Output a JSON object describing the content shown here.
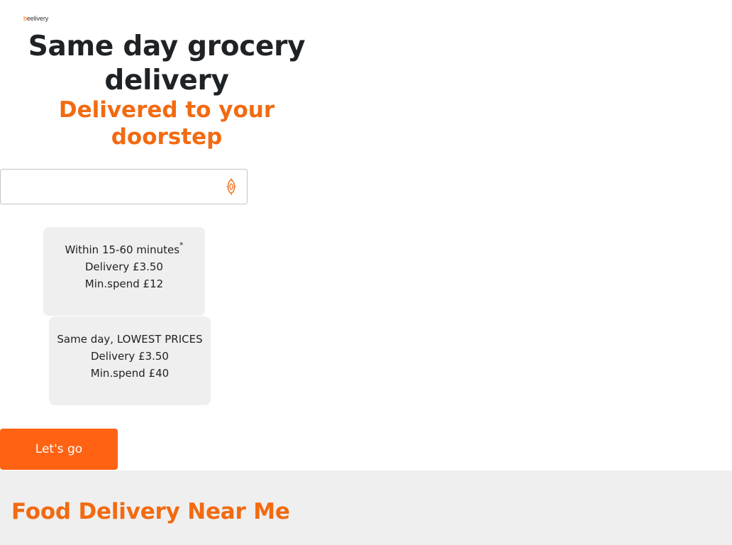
{
  "brand": {
    "logo_first": "b",
    "logo_rest": "eelivery",
    "accent_color": "#ff6212"
  },
  "hero": {
    "title": "Same day grocery delivery",
    "subtitle": "Delivered to your doorstep"
  },
  "address": {
    "value": "",
    "placeholder": "",
    "locate_icon": "location-target-icon"
  },
  "options": [
    {
      "time_label": "Within 15-60 minutes",
      "footnote": "*",
      "delivery": "Delivery £3.50",
      "min_spend": "Min.spend £12"
    },
    {
      "time_label": "Same day, LOWEST PRICES",
      "delivery": "Delivery £3.50",
      "min_spend": "Min.spend £40"
    }
  ],
  "cta": {
    "label": "Let's go"
  },
  "near_me": {
    "title": "Food Delivery Near Me"
  }
}
